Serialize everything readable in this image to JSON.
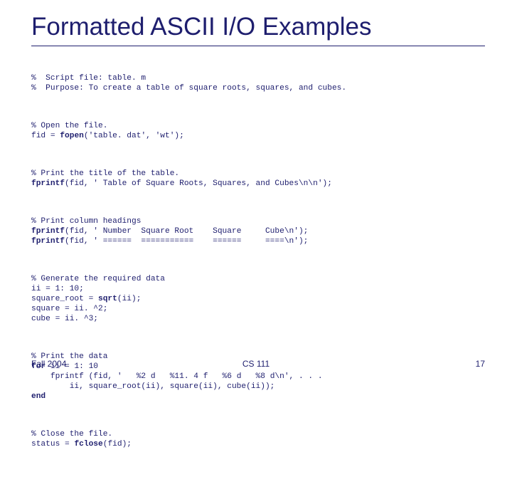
{
  "title": "Formatted ASCII I/O Examples",
  "code": {
    "b1l1": "%  Script file: table. m",
    "b1l2": "%  Purpose: To create a table of square roots, squares, and cubes.",
    "b2l1": "% Open the file.",
    "b2l2a": "fid = ",
    "b2l2b": "fopen",
    "b2l2c": "('table. dat', 'wt');",
    "b3l1": "% Print the title of the table.",
    "b3l2a": "fprintf",
    "b3l2b": "(fid, ' Table of Square Roots, Squares, and Cubes\\n\\n');",
    "b4l1": "% Print column headings",
    "b4l2a": "fprintf",
    "b4l2b": "(fid, ' Number  Square Root    Square     Cube\\n');",
    "b4l3a": "fprintf",
    "b4l3b": "(fid, ' ======  ===========    ======     ====\\n');",
    "b5l1": "% Generate the required data",
    "b5l2": "ii = 1: 10;",
    "b5l3a": "square_root = ",
    "b5l3b": "sqrt",
    "b5l3c": "(ii);",
    "b5l4": "square = ii. ^2;",
    "b5l5": "cube = ii. ^3;",
    "b6l1": "% Print the data",
    "b6l2a": "for",
    "b6l2b": " ii = 1: 10",
    "b6l3a": "    fprintf ",
    "b6l3b": "(fid, '   %2 d   %11. 4 f   %6 d   %8 d\\n', . . .",
    "b6l4": "        ii, square_root(ii), square(ii), cube(ii));",
    "b6l5": "end",
    "b7l1": "% Close the file.",
    "b7l2a": "status = ",
    "b7l2b": "fclose",
    "b7l2c": "(fid);"
  },
  "footer": {
    "left": "Fall 2004",
    "center": "CS 111",
    "right": "17"
  }
}
